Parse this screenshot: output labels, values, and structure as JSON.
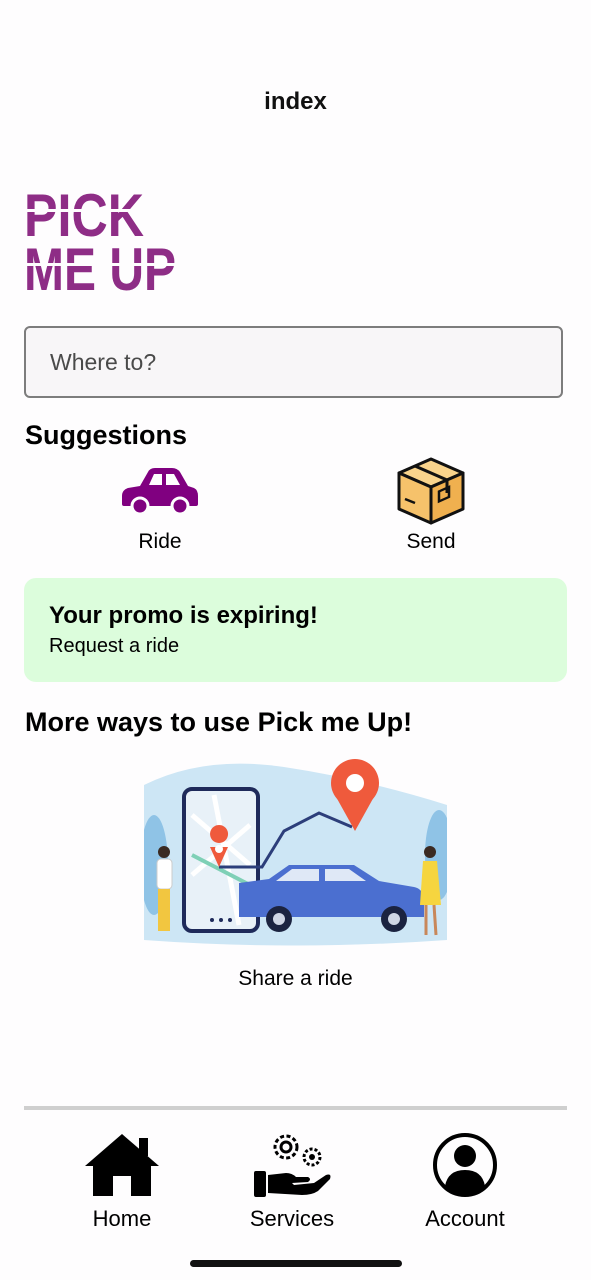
{
  "header": {
    "title": "index"
  },
  "logo": {
    "line1": "PICK",
    "line2": "ME UP",
    "color": "#8e2d86"
  },
  "search": {
    "placeholder": "Where to?"
  },
  "suggestions": {
    "title": "Suggestions",
    "items": [
      {
        "label": "Ride",
        "icon": "car-icon",
        "color": "#800080"
      },
      {
        "label": "Send",
        "icon": "package-icon",
        "color": "#f6c26b"
      }
    ]
  },
  "promo": {
    "title": "Your promo is expiring!",
    "subtitle": "Request a ride",
    "background": "#dcfddc"
  },
  "more": {
    "title": "More ways to use Pick me Up!",
    "caption": "Share a ride"
  },
  "nav": {
    "items": [
      {
        "label": "Home",
        "icon": "home-icon"
      },
      {
        "label": "Services",
        "icon": "services-icon"
      },
      {
        "label": "Account",
        "icon": "account-icon"
      }
    ]
  }
}
